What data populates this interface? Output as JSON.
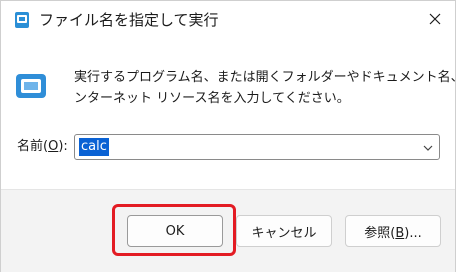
{
  "window": {
    "title": "ファイル名を指定して実行",
    "title_icon": "run-dialog-icon",
    "close_icon": "close-icon"
  },
  "main": {
    "icon": "run-icon",
    "description_lines": [
      "実行するプログラム名、または開くフォルダーやドキュメント名、イ",
      "ンターネット リソース名を入力してください。"
    ],
    "name_label_prefix": "名前(",
    "name_label_key": "O",
    "name_label_suffix": "):",
    "input_value": "calc"
  },
  "buttons": {
    "ok": "OK",
    "cancel": "キャンセル",
    "browse_prefix": "参照(",
    "browse_key": "B",
    "browse_suffix": ")..."
  },
  "colors": {
    "selection": "#0a62d4",
    "highlight_box": "#e31b23",
    "footer_bg": "#f3f3f3"
  }
}
